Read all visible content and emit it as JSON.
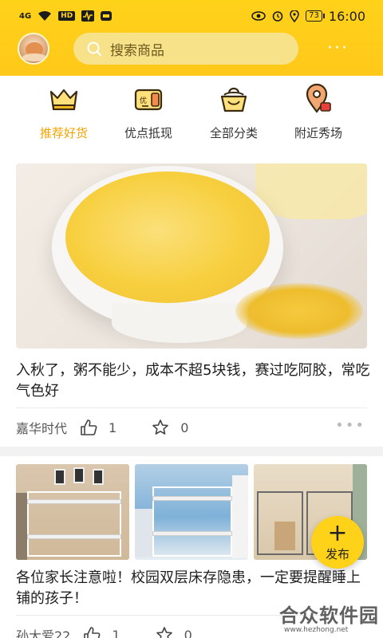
{
  "status_bar": {
    "signal": "4G",
    "hd": "HD",
    "time": "16:00",
    "battery": "73"
  },
  "header": {
    "search_placeholder": "搜索商品",
    "more": "···"
  },
  "categories": [
    {
      "label": "推荐好货",
      "icon": "crown-icon",
      "active": true
    },
    {
      "label": "优点抵现",
      "icon": "coupon-icon",
      "active": false
    },
    {
      "label": "全部分类",
      "icon": "basket-icon",
      "active": false
    },
    {
      "label": "附近秀场",
      "icon": "location-pin-icon",
      "active": false
    }
  ],
  "posts": [
    {
      "title": "入秋了，粥不能少，成本不超5块钱，赛过吃阿胶，常吃气色好",
      "author": "嘉华时代",
      "likes": "1",
      "favorites": "0"
    },
    {
      "title": "各位家长注意啦！校园双层床存隐患，一定要提醒睡上铺的孩子！",
      "author": "孙大爱22",
      "likes": "1",
      "favorites": "0"
    }
  ],
  "fab": {
    "label": "发布",
    "plus": "+"
  },
  "watermark": {
    "main": "合众软件园",
    "sub": "www.hezhong.net"
  },
  "colors": {
    "accent": "#ffd21a",
    "active_tab": "#f2a400"
  }
}
